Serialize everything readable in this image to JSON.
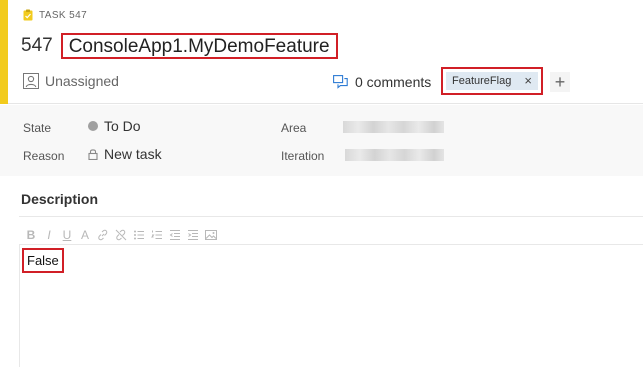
{
  "work_item": {
    "type_label": "TASK 547",
    "id": "547",
    "title": "ConsoleApp1.MyDemoFeature",
    "assigned_to": "Unassigned",
    "comments_label": "0 comments",
    "tags": [
      {
        "label": "FeatureFlag",
        "remove_symbol": "×"
      }
    ],
    "add_tag_symbol": "+",
    "accent_color": "#f2cb1d"
  },
  "fields": {
    "state_label": "State",
    "state_value": "To Do",
    "reason_label": "Reason",
    "reason_value": "New task",
    "area_label": "Area",
    "iteration_label": "Iteration"
  },
  "description": {
    "title": "Description",
    "value": "False",
    "toolbar": [
      {
        "name": "bold-button",
        "glyph": "B"
      },
      {
        "name": "italic-button",
        "glyph": "I"
      },
      {
        "name": "underline-button",
        "glyph": "U"
      },
      {
        "name": "highlight-button",
        "glyph": "A"
      },
      {
        "name": "insert-link-button",
        "glyph": ""
      },
      {
        "name": "remove-link-button",
        "glyph": ""
      },
      {
        "name": "bulleted-list-button",
        "glyph": ""
      },
      {
        "name": "numbered-list-button",
        "glyph": ""
      },
      {
        "name": "decrease-indent-button",
        "glyph": ""
      },
      {
        "name": "increase-indent-button",
        "glyph": ""
      },
      {
        "name": "insert-image-button",
        "glyph": ""
      }
    ]
  },
  "colors": {
    "highlight_border": "#d11f26",
    "tag_background": "#dfe9f2"
  }
}
